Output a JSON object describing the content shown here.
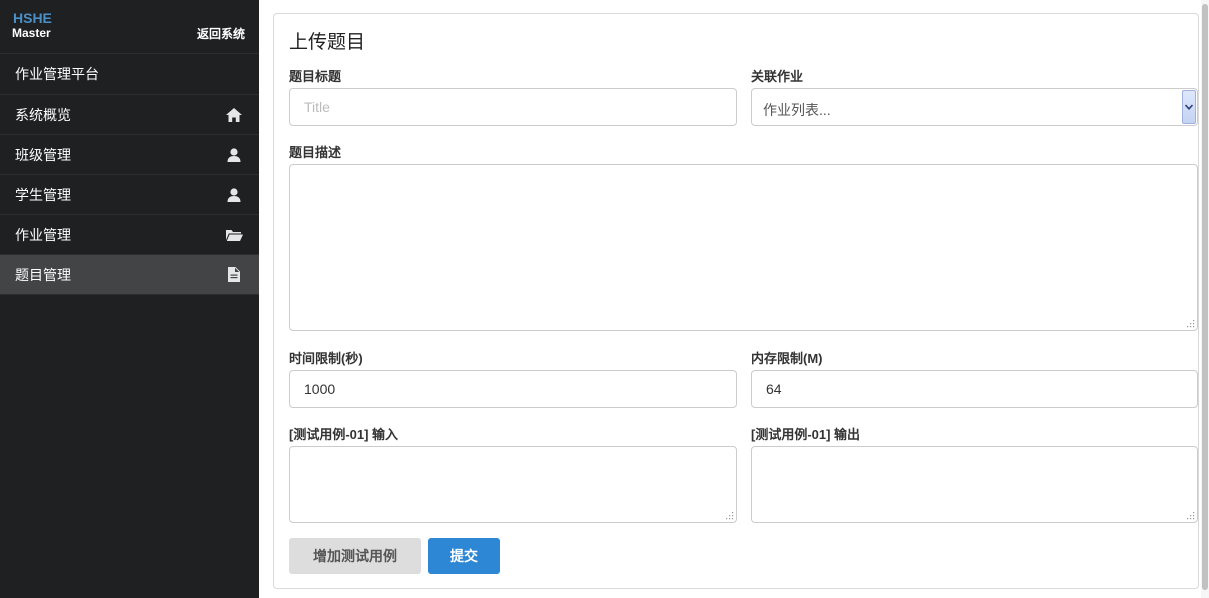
{
  "sidebar": {
    "brand_top": "HSHE",
    "brand_bottom": "Master",
    "return_label": "返回系统",
    "platform": "作业管理平台",
    "items": [
      {
        "label": "系统概览",
        "icon": "home-icon"
      },
      {
        "label": "班级管理",
        "icon": "user-icon"
      },
      {
        "label": "学生管理",
        "icon": "user-icon"
      },
      {
        "label": "作业管理",
        "icon": "folder-open-icon"
      },
      {
        "label": "题目管理",
        "icon": "file-icon",
        "active": true
      }
    ]
  },
  "form": {
    "title": "上传题目",
    "title_label": "题目标题",
    "title_placeholder": "Title",
    "assignment_label": "关联作业",
    "assignment_value": "作业列表...",
    "description_label": "题目描述",
    "time_limit_label": "时间限制(秒)",
    "time_limit_value": "1000",
    "memory_limit_label": "内存限制(M)",
    "memory_limit_value": "64",
    "test_input_label": "[测试用例-01] 输入",
    "test_output_label": "[测试用例-01] 输出",
    "add_test_button": "增加测试用例",
    "submit_button": "提交"
  }
}
